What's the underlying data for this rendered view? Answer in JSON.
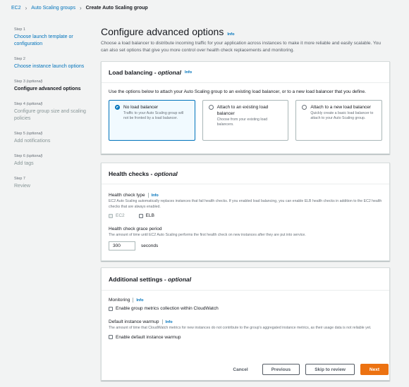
{
  "breadcrumb": [
    "EC2",
    "Auto Scaling groups",
    "Create Auto Scaling group"
  ],
  "steps": [
    {
      "num": "Step 1",
      "optional": "",
      "label": "Choose launch template or configuration",
      "state": "link"
    },
    {
      "num": "Step 2",
      "optional": "",
      "label": "Choose instance launch options",
      "state": "link"
    },
    {
      "num": "Step 3",
      "optional": "(optional)",
      "label": "Configure advanced options",
      "state": "current"
    },
    {
      "num": "Step 4",
      "optional": "(optional)",
      "label": "Configure group size and scaling policies",
      "state": "disabled"
    },
    {
      "num": "Step 5",
      "optional": "(optional)",
      "label": "Add notifications",
      "state": "disabled"
    },
    {
      "num": "Step 6",
      "optional": "(optional)",
      "label": "Add tags",
      "state": "disabled"
    },
    {
      "num": "Step 7",
      "optional": "",
      "label": "Review",
      "state": "disabled"
    }
  ],
  "page": {
    "title": "Configure advanced options",
    "info": "Info",
    "description": "Choose a load balancer to distribute incoming traffic for your application across instances to make it more reliable and easily scalable. You can also set options that give you more control over health check replacements and monitoring."
  },
  "load_balancing": {
    "title": "Load balancing - ",
    "title_opt": "optional",
    "info": "Info",
    "intro": "Use the options below to attach your Auto Scaling group to an existing load balancer, or to a new load balancer that you define.",
    "options": [
      {
        "title": "No load balancer",
        "desc": "Traffic to your Auto Scaling group will not be fronted by a load balancer.",
        "selected": true
      },
      {
        "title": "Attach to an existing load balancer",
        "desc": "Choose from your existing load balancers.",
        "selected": false
      },
      {
        "title": "Attach to a new load balancer",
        "desc": "Quickly create a basic load balancer to attach to your Auto Scaling group.",
        "selected": false
      }
    ]
  },
  "health_checks": {
    "title": "Health checks - ",
    "title_opt": "optional",
    "type_label": "Health check type",
    "info": "Info",
    "type_desc": "EC2 Auto Scaling automatically replaces instances that fail health checks. If you enabled load balancing, you can enable ELB health checks in addition to the EC2 health checks that are always enabled.",
    "ec2_label": "EC2",
    "elb_label": "ELB",
    "grace_label": "Health check grace period",
    "grace_desc": "The amount of time until EC2 Auto Scaling performs the first health check on new instances after they are put into service.",
    "grace_value": "300",
    "grace_unit": "seconds"
  },
  "additional": {
    "title": "Additional settings - ",
    "title_opt": "optional",
    "monitoring_label": "Monitoring",
    "info": "Info",
    "monitoring_check": "Enable group metrics collection within CloudWatch",
    "warmup_label": "Default instance warmup",
    "warmup_desc": "The amount of time that CloudWatch metrics for new instances do not contribute to the group's aggregated instance metrics, as their usage data is not reliable yet.",
    "warmup_check": "Enable default instance warmup"
  },
  "footer": {
    "cancel": "Cancel",
    "previous": "Previous",
    "skip": "Skip to review",
    "next": "Next"
  },
  "colors": {
    "accent": "#0073bb",
    "primary_button": "#ec7211"
  }
}
